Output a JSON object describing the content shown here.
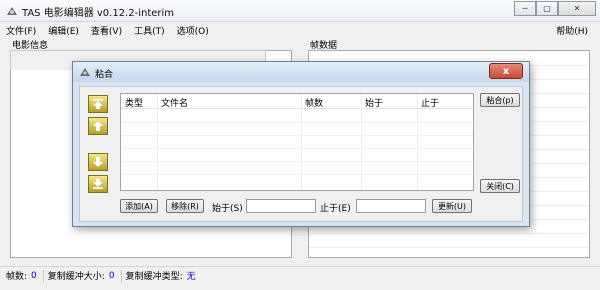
{
  "window": {
    "title": "TAS 电影编辑器 v0.12.2-interim",
    "minimize": "─",
    "restore": "▢",
    "close": "✕"
  },
  "menu": {
    "file": "文件(F)",
    "edit": "编辑(E)",
    "view": "查看(V)",
    "tools": "工具(T)",
    "options": "选项(O)",
    "help": "帮助(H)"
  },
  "panels": {
    "movie_info": "电影信息",
    "frame_data": "帧数据"
  },
  "status": {
    "frames_label": "帧数:",
    "frames_value": "0",
    "clip_size_label": "复制缓冲大小:",
    "clip_size_value": "0",
    "clip_type_label": "复制缓冲类型:",
    "clip_type_value": "无"
  },
  "dialog": {
    "title": "粘合",
    "close": "x",
    "columns": [
      "类型",
      "文件名",
      "帧数",
      "始于",
      "止于"
    ],
    "splice_button": "粘合(p)",
    "close_button": "关闭(C)",
    "add_button": "添加(A)",
    "remove_button": "移除(R)",
    "start_label": "始于(S)",
    "end_label": "止于(E)",
    "update_button": "更新(U)",
    "start_value": "",
    "end_value": ""
  },
  "icons": {
    "app": "film-editor-icon",
    "dialog": "film-editor-icon",
    "move_top": "arrow-to-top-icon",
    "move_up": "arrow-up-icon",
    "move_down": "arrow-down-icon",
    "move_bottom": "arrow-to-bottom-icon"
  },
  "colors": {
    "status_value_blue": "#0000ff",
    "dialog_close_red": "#c44a38",
    "arrow_button_gold": "#b4a12a"
  }
}
